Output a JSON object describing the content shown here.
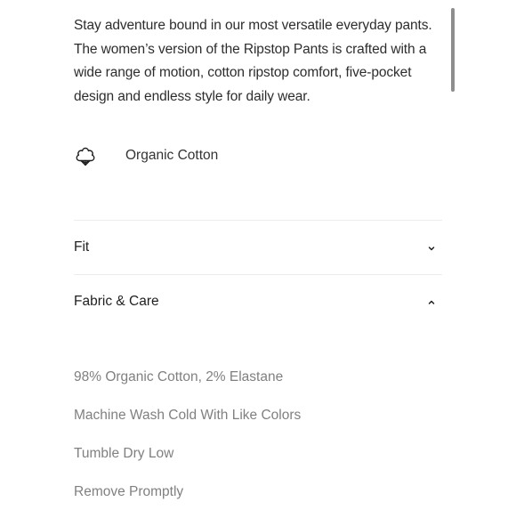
{
  "description": "Stay adventure bound in our most versatile everyday pants. The women’s version of the Ripstop Pants is crafted with a wide range of motion, cotton ripstop comfort, five-pocket design and endless style for daily wear.",
  "material": {
    "icon": "cotton-boll-icon",
    "label": "Organic Cotton"
  },
  "accordions": [
    {
      "title": "Fit",
      "expanded": false,
      "icon": "chevron-down-icon"
    },
    {
      "title": "Fabric & Care",
      "expanded": true,
      "icon": "chevron-up-icon"
    }
  ],
  "fabric_care": {
    "items": [
      "98% Organic Cotton, 2% Elastane",
      "Machine Wash Cold With Like Colors",
      "Tumble Dry Low",
      "Remove Promptly"
    ]
  },
  "colors": {
    "text": "#2d2d2d",
    "muted_text": "#808080",
    "divider": "#ececec",
    "scrollbar": "#8e8e8e"
  }
}
